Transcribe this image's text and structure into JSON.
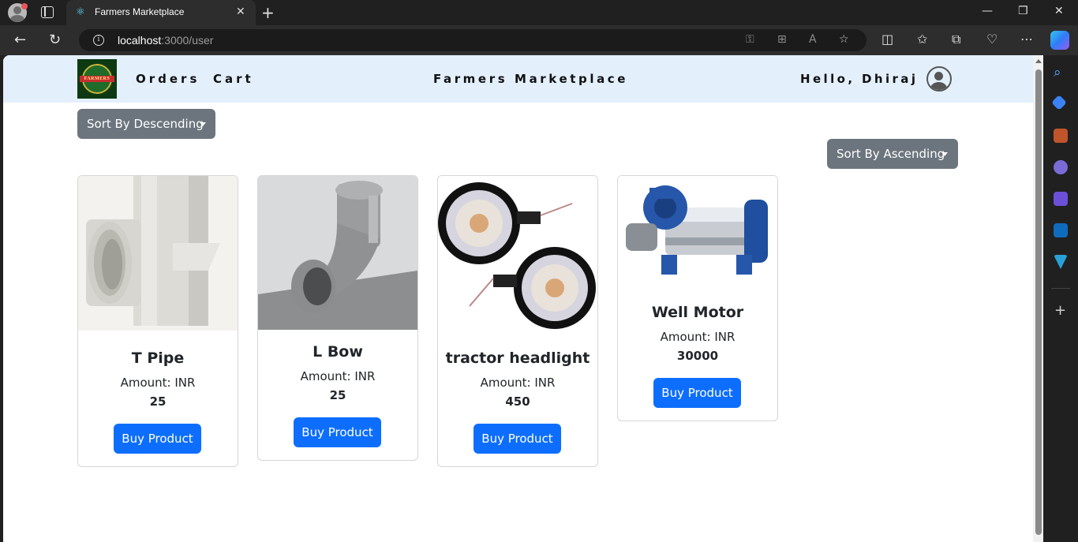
{
  "browser": {
    "tab_title": "Farmers Marketplace",
    "url_host": "localhost",
    "url_path": ":3000/user"
  },
  "nav": {
    "orders": "Orders",
    "cart": "Cart",
    "brand": "Farmers Marketplace",
    "greeting": "Hello, Dhiraj",
    "logo_text": "FARMERS"
  },
  "sort": {
    "descending": "Sort By Descending",
    "ascending": "Sort By Ascending"
  },
  "products": [
    {
      "name": "T Pipe",
      "amount_label": "Amount: INR",
      "amount": "25",
      "button": "Buy Product",
      "image_icon": "t-pipe-image"
    },
    {
      "name": "L Bow",
      "amount_label": "Amount: INR",
      "amount": "25",
      "button": "Buy Product",
      "image_icon": "l-bow-image"
    },
    {
      "name": "tractor headlight",
      "amount_label": "Amount: INR",
      "amount": "450",
      "button": "Buy Product",
      "image_icon": "tractor-headlight-image"
    },
    {
      "name": "Well Motor",
      "amount_label": "Amount: INR",
      "amount": "30000",
      "button": "Buy Product",
      "image_icon": "well-motor-image"
    }
  ],
  "colors": {
    "primary": "#0d6efd",
    "secondary": "#6c757d",
    "navbar_bg": "#e3f0fc"
  }
}
